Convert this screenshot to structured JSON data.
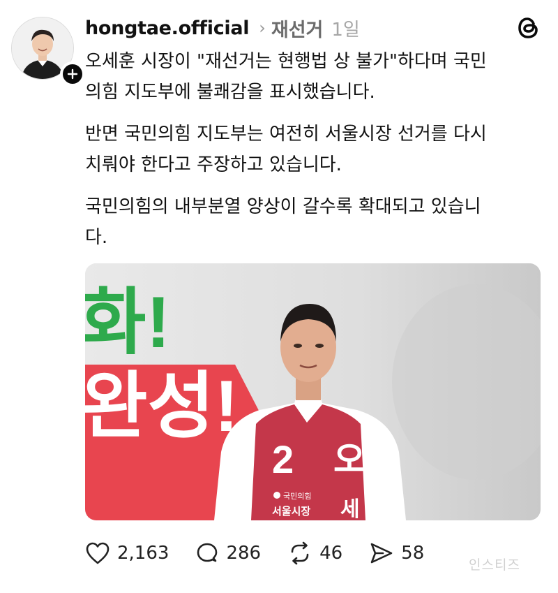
{
  "post": {
    "username": "hongtae.official",
    "topic": "재선거",
    "time": "1일",
    "paragraphs": [
      "오세훈 시장이 \"재선거는 현행법 상 불가\"하다며 국민\n의힘 지도부에 불쾌감을 표시했습니다.",
      "반면 국민의힘 지도부는 여전히 서울시장 선거를 다시\n치뤄야 한다고 주장하고 있습니다.",
      "국민의힘의 내부분열 양상이 갈수록 확대되고 있습니\n다."
    ],
    "image": {
      "banner_text_1": "화!",
      "banner_text_2": "완성!",
      "vest_number": "2",
      "vest_name_1": "오",
      "vest_name_2": "세",
      "vest_party": "국민의힘",
      "vest_title": "서울시장"
    }
  },
  "actions": {
    "likes": "2,163",
    "replies": "286",
    "reposts": "46",
    "shares": "58"
  },
  "watermark": "인스티즈",
  "icons": [
    "plus-icon",
    "chevron-right-icon",
    "threads-logo-icon",
    "heart-icon",
    "comment-icon",
    "repost-icon",
    "share-icon"
  ]
}
